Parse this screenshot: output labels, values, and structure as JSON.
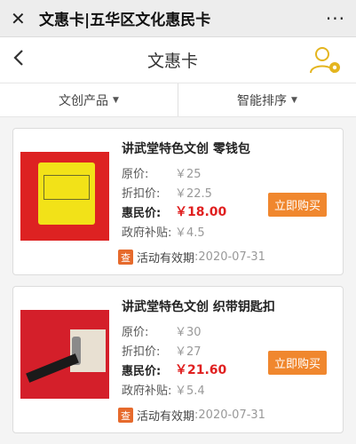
{
  "wechat": {
    "close_icon": "close-icon",
    "title": "文惠卡|五华区文化惠民卡",
    "more": "···"
  },
  "header": {
    "back_icon": "chevron-left-icon",
    "title": "文惠卡",
    "settings_icon": "user-gear-icon"
  },
  "filters": [
    {
      "label": "文创产品"
    },
    {
      "label": "智能排序"
    }
  ],
  "products": [
    {
      "name": "讲武堂特色文创 零钱包",
      "original_label": "原价:",
      "original": "￥25",
      "discount_label": "折扣价:",
      "discount": "￥22.5",
      "hui_label": "惠民价:",
      "hui": "￥18.00",
      "subsidy_label": "政府补贴:",
      "subsidy": "￥4.5",
      "buy": "立即购买",
      "validity_tag": "查",
      "validity_label": "活动有效期",
      "validity_date": ":2020-07-31"
    },
    {
      "name": "讲武堂特色文创 织带钥匙扣",
      "original_label": "原价:",
      "original": "￥30",
      "discount_label": "折扣价:",
      "discount": "￥27",
      "hui_label": "惠民价:",
      "hui": "￥21.60",
      "subsidy_label": "政府补贴:",
      "subsidy": "￥5.4",
      "buy": "立即购买",
      "validity_tag": "查",
      "validity_label": "活动有效期",
      "validity_date": ":2020-07-31"
    }
  ],
  "colors": {
    "accent": "#f0872e",
    "price": "#e02020",
    "icon_gold": "#e4b51f"
  }
}
